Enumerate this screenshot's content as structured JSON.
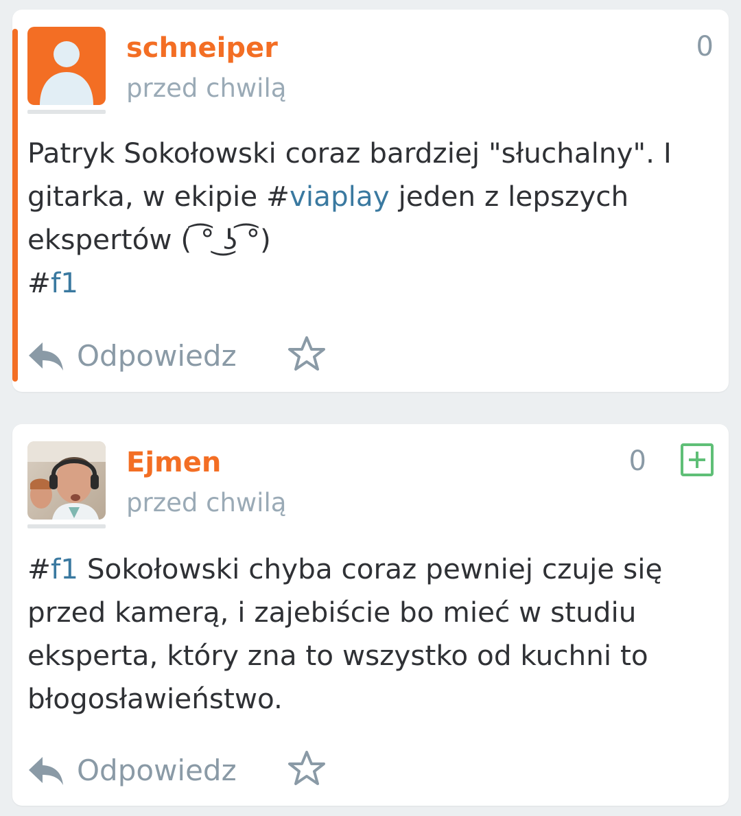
{
  "posts": [
    {
      "author": "schneiper",
      "time": "przed chwilą",
      "votes": "0",
      "avatar_icon": "default-user-avatar",
      "text_segments": [
        {
          "text": "Patryk Sokołowski coraz bardziej \"słuchalny\". I gitarka, w ekipie #",
          "type": "plain"
        },
        {
          "text": "viaplay",
          "type": "tag"
        },
        {
          "text": " jeden z lepszych ekspertów ( ͡° ͜ʖ ͡°)",
          "type": "plain"
        }
      ],
      "tag_line": {
        "hash": "#",
        "tag": "f1"
      },
      "reply_label": "Odpowiedz"
    },
    {
      "author": "Ejmen",
      "time": "przed chwilą",
      "votes": "0",
      "avatar_icon": "user-photo-avatar",
      "hash": "#",
      "tag": "f1",
      "text": " Sokołowski chyba coraz pewniej czuje się przed kamerą, i zajebiście bo mieć w studiu eksperta, który zna to wszystko od kuchni to błogosławieństwo.",
      "reply_label": "Odpowiedz"
    }
  ],
  "colors": {
    "accent": "#f36e24",
    "tag": "#3a79a0",
    "plus": "#5fbf77",
    "muted": "#8a9aa6"
  }
}
